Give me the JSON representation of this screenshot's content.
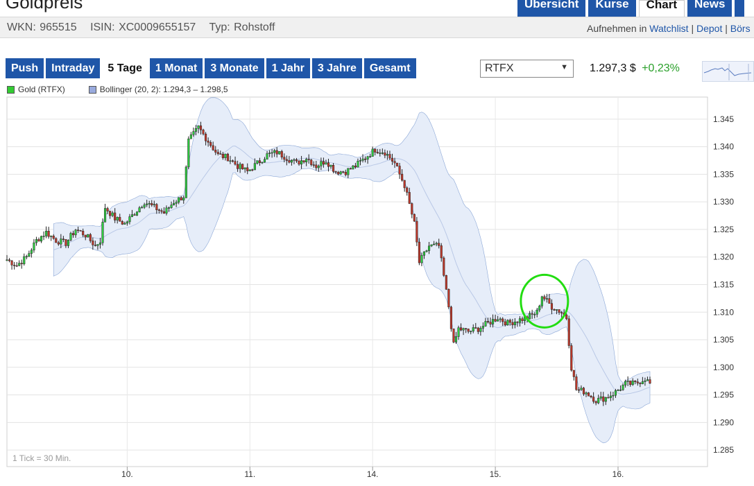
{
  "page": {
    "title": "Goldpreis",
    "top_tabs": [
      {
        "label": "Übersicht",
        "active": false
      },
      {
        "label": "Kurse",
        "active": false
      },
      {
        "label": "Chart",
        "active": true
      },
      {
        "label": "News",
        "active": false
      }
    ]
  },
  "info": {
    "wkn": "WKN: 965515",
    "isin": "ISIN: XC0009655157",
    "type": "Typ: Rohstoff",
    "add_to": "Aufnehmen in",
    "watchlist": "Watchlist",
    "sep": "|",
    "depot": "Depot",
    "sep2": "|",
    "boerse": "Börs"
  },
  "controls": {
    "ranges": [
      "Push",
      "Intraday",
      "5 Tage",
      "1 Monat",
      "3 Monate",
      "1 Jahr",
      "3 Jahre",
      "Gesamt"
    ],
    "active_range": "5 Tage",
    "exchange": "RTFX",
    "price": "1.297,3 $",
    "change": "+0,23%"
  },
  "colors": {
    "brand": "#1f56a8",
    "up": "#2ecc40",
    "down": "#c0392b",
    "band": "#e6edf9",
    "band_edge": "#8aa6d6",
    "highlight": "#22dd11"
  },
  "chart_data": {
    "type": "candlestick",
    "legend": [
      {
        "name": "Gold (RTFX)",
        "color": "#33cc33"
      },
      {
        "name": "Bollinger (20, 2): 1.294,3 – 1.298,5",
        "color": "#99aadd"
      }
    ],
    "x_labels": [
      "10.",
      "11.",
      "14.",
      "15.",
      "16."
    ],
    "y_ticks": [
      "1.345",
      "1.340",
      "1.335",
      "1.330",
      "1.325",
      "1.320",
      "1.315",
      "1.310",
      "1.305",
      "1.300",
      "1.295",
      "1.290",
      "1.285"
    ],
    "ylim": [
      1282,
      1349
    ],
    "tick_note": "1 Tick = 30 Min.",
    "annotation": "green circle around 15. peak",
    "price_anchors": [
      [
        0,
        1319.5
      ],
      [
        4,
        1318.5
      ],
      [
        8,
        1320
      ],
      [
        12,
        1323
      ],
      [
        16,
        1324.5
      ],
      [
        20,
        1323
      ],
      [
        24,
        1322.5
      ],
      [
        28,
        1325
      ],
      [
        32,
        1324
      ],
      [
        36,
        1322
      ],
      [
        38,
        1323
      ],
      [
        40,
        1329
      ],
      [
        44,
        1327
      ],
      [
        48,
        1326
      ],
      [
        52,
        1328
      ],
      [
        56,
        1330
      ],
      [
        60,
        1329
      ],
      [
        64,
        1328
      ],
      [
        68,
        1330
      ],
      [
        72,
        1331
      ],
      [
        74,
        1341
      ],
      [
        78,
        1343.5
      ],
      [
        82,
        1341
      ],
      [
        86,
        1338.5
      ],
      [
        90,
        1338
      ],
      [
        94,
        1336.5
      ],
      [
        98,
        1335.5
      ],
      [
        102,
        1337
      ],
      [
        106,
        1338.5
      ],
      [
        110,
        1339
      ],
      [
        114,
        1338
      ],
      [
        118,
        1337
      ],
      [
        122,
        1338
      ],
      [
        126,
        1336.5
      ],
      [
        130,
        1337.5
      ],
      [
        134,
        1335.5
      ],
      [
        138,
        1335.5
      ],
      [
        142,
        1336.5
      ],
      [
        146,
        1338
      ],
      [
        150,
        1339.5
      ],
      [
        154,
        1339
      ],
      [
        158,
        1337
      ],
      [
        162,
        1333
      ],
      [
        166,
        1326
      ],
      [
        168,
        1319
      ],
      [
        172,
        1322
      ],
      [
        176,
        1322
      ],
      [
        180,
        1311
      ],
      [
        182,
        1304
      ],
      [
        184,
        1307
      ],
      [
        188,
        1306.5
      ],
      [
        192,
        1307
      ],
      [
        196,
        1308
      ],
      [
        200,
        1309
      ],
      [
        204,
        1308
      ],
      [
        208,
        1308.5
      ],
      [
        212,
        1309
      ],
      [
        216,
        1310
      ],
      [
        218,
        1313
      ],
      [
        222,
        1311
      ],
      [
        226,
        1310
      ],
      [
        228,
        1309
      ],
      [
        230,
        1300
      ],
      [
        232,
        1296
      ],
      [
        236,
        1295.5
      ],
      [
        240,
        1294
      ],
      [
        244,
        1294.5
      ],
      [
        248,
        1295.5
      ],
      [
        252,
        1297
      ],
      [
        256,
        1297
      ],
      [
        260,
        1298
      ],
      [
        262,
        1297
      ]
    ],
    "candle_count": 263
  }
}
